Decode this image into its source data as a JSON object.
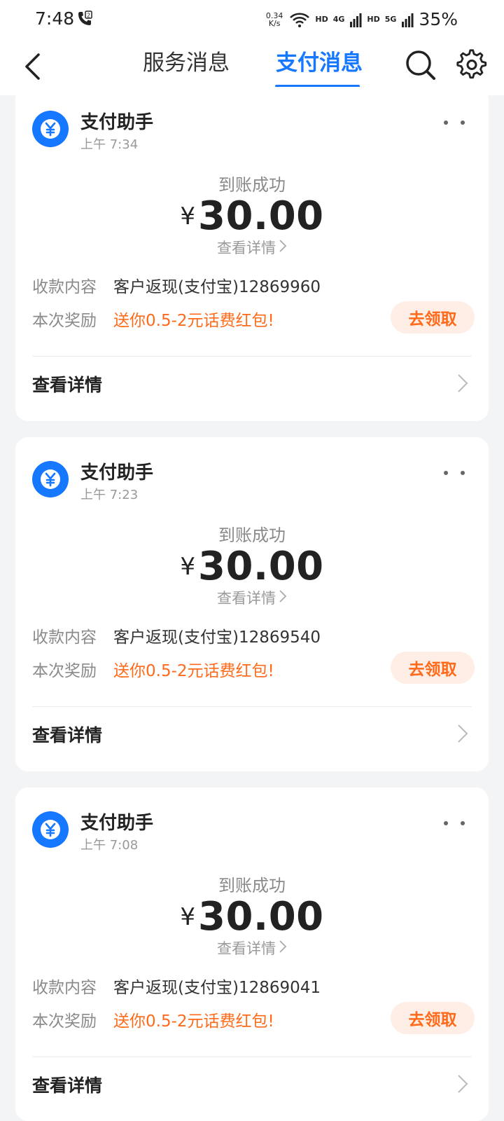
{
  "status_bar": {
    "time": "7:48",
    "net_speed_value": "0.34",
    "net_speed_unit": "K/s",
    "hd1": "HD",
    "net_4g": "4G",
    "hd2": "HD",
    "net_5g": "5G",
    "battery": "35%"
  },
  "header": {
    "tabs": [
      {
        "label": "服务消息",
        "active": false
      },
      {
        "label": "支付消息",
        "active": true
      }
    ],
    "accent_color": "#1677ff"
  },
  "cards": [
    {
      "sender": "支付助手",
      "time": "上午 7:34",
      "status": "到账成功",
      "currency": "¥",
      "amount": "30.00",
      "detail_link": "查看详情",
      "content_label": "收款内容",
      "content_value": "客户返现(支付宝)12869960",
      "reward_label": "本次奖励",
      "reward_value": "送你0.5-2元话费红包!",
      "claim_label": "去领取",
      "footer_label": "查看详情"
    },
    {
      "sender": "支付助手",
      "time": "上午 7:23",
      "status": "到账成功",
      "currency": "¥",
      "amount": "30.00",
      "detail_link": "查看详情",
      "content_label": "收款内容",
      "content_value": "客户返现(支付宝)12869540",
      "reward_label": "本次奖励",
      "reward_value": "送你0.5-2元话费红包!",
      "claim_label": "去领取",
      "footer_label": "查看详情"
    },
    {
      "sender": "支付助手",
      "time": "上午 7:08",
      "status": "到账成功",
      "currency": "¥",
      "amount": "30.00",
      "detail_link": "查看详情",
      "content_label": "收款内容",
      "content_value": "客户返现(支付宝)12869041",
      "reward_label": "本次奖励",
      "reward_value": "送你0.5-2元话费红包!",
      "claim_label": "去领取",
      "footer_label": "查看详情"
    }
  ],
  "colors": {
    "reward_orange": "#ff6a1a",
    "claim_bg": "#ffeee5",
    "page_bg": "#f3f4f6"
  },
  "icons": {
    "back": "chevron-left-icon",
    "search": "search-icon",
    "settings": "gear-icon",
    "app": "yuan-icon",
    "more": "more-dots-icon",
    "footer": "chevron-right-icon"
  }
}
